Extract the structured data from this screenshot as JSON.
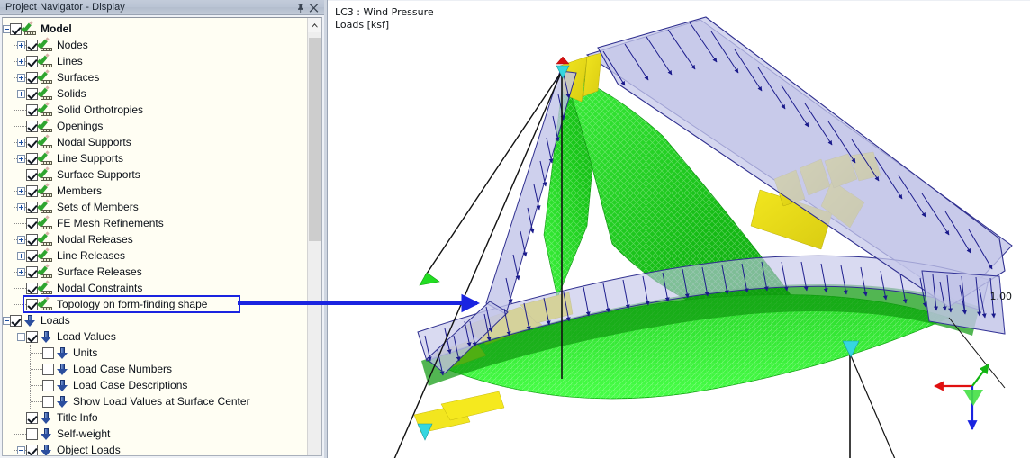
{
  "panel": {
    "title": "Project Navigator - Display",
    "pin_icon": "pin-icon",
    "close_icon": "close-icon",
    "scroll_up_icon": "chevron-up-icon"
  },
  "tree": {
    "items": [
      {
        "label": "Model",
        "depth": 0,
        "checked": true,
        "expander": "minus",
        "icon": "display-icon",
        "bold": true
      },
      {
        "label": "Nodes",
        "depth": 1,
        "checked": true,
        "expander": "plus",
        "icon": "display-icon",
        "bold": false
      },
      {
        "label": "Lines",
        "depth": 1,
        "checked": true,
        "expander": "plus",
        "icon": "display-icon",
        "bold": false
      },
      {
        "label": "Surfaces",
        "depth": 1,
        "checked": true,
        "expander": "plus",
        "icon": "display-icon",
        "bold": false
      },
      {
        "label": "Solids",
        "depth": 1,
        "checked": true,
        "expander": "plus",
        "icon": "display-icon",
        "bold": false
      },
      {
        "label": "Solid Orthotropies",
        "depth": 1,
        "checked": true,
        "expander": "none",
        "icon": "display-icon",
        "bold": false
      },
      {
        "label": "Openings",
        "depth": 1,
        "checked": true,
        "expander": "none",
        "icon": "display-icon",
        "bold": false
      },
      {
        "label": "Nodal Supports",
        "depth": 1,
        "checked": true,
        "expander": "plus",
        "icon": "display-icon",
        "bold": false
      },
      {
        "label": "Line Supports",
        "depth": 1,
        "checked": true,
        "expander": "plus",
        "icon": "display-icon",
        "bold": false
      },
      {
        "label": "Surface Supports",
        "depth": 1,
        "checked": true,
        "expander": "none",
        "icon": "display-icon",
        "bold": false
      },
      {
        "label": "Members",
        "depth": 1,
        "checked": true,
        "expander": "plus",
        "icon": "display-icon",
        "bold": false
      },
      {
        "label": "Sets of Members",
        "depth": 1,
        "checked": true,
        "expander": "plus",
        "icon": "display-icon",
        "bold": false
      },
      {
        "label": "FE Mesh Refinements",
        "depth": 1,
        "checked": true,
        "expander": "none",
        "icon": "display-icon",
        "bold": false
      },
      {
        "label": "Nodal Releases",
        "depth": 1,
        "checked": true,
        "expander": "plus",
        "icon": "display-icon",
        "bold": false
      },
      {
        "label": "Line Releases",
        "depth": 1,
        "checked": true,
        "expander": "plus",
        "icon": "display-icon",
        "bold": false
      },
      {
        "label": "Surface Releases",
        "depth": 1,
        "checked": true,
        "expander": "plus",
        "icon": "display-icon",
        "bold": false
      },
      {
        "label": "Nodal Constraints",
        "depth": 1,
        "checked": true,
        "expander": "none",
        "icon": "display-icon",
        "bold": false
      },
      {
        "label": "Topology on form-finding shape",
        "depth": 1,
        "checked": true,
        "expander": "none",
        "icon": "display-icon",
        "bold": false,
        "highlighted": true
      },
      {
        "label": "Loads",
        "depth": 0,
        "checked": true,
        "expander": "minus",
        "icon": "load-icon",
        "bold": false
      },
      {
        "label": "Load Values",
        "depth": 1,
        "checked": true,
        "expander": "minus",
        "icon": "load-icon",
        "bold": false
      },
      {
        "label": "Units",
        "depth": 2,
        "checked": false,
        "expander": "none",
        "icon": "load-icon",
        "bold": false
      },
      {
        "label": "Load Case Numbers",
        "depth": 2,
        "checked": false,
        "expander": "none",
        "icon": "load-icon",
        "bold": false
      },
      {
        "label": "Load Case Descriptions",
        "depth": 2,
        "checked": false,
        "expander": "none",
        "icon": "load-icon",
        "bold": false
      },
      {
        "label": "Show Load Values at Surface Center",
        "depth": 2,
        "checked": false,
        "expander": "none",
        "icon": "load-icon",
        "bold": false
      },
      {
        "label": "Title Info",
        "depth": 1,
        "checked": true,
        "expander": "none",
        "icon": "load-icon",
        "bold": false
      },
      {
        "label": "Self-weight",
        "depth": 1,
        "checked": false,
        "expander": "none",
        "icon": "load-icon",
        "bold": false
      },
      {
        "label": "Object Loads",
        "depth": 1,
        "checked": true,
        "expander": "minus",
        "icon": "load-icon",
        "bold": false
      }
    ]
  },
  "view": {
    "caption_line1": "LC3 : Wind Pressure",
    "caption_line2": "Loads [ksf]",
    "value_label": "1.00",
    "axis": {
      "x": "X",
      "y": "Y",
      "z": "Z"
    }
  },
  "colors": {
    "highlight_border": "#1a24e0",
    "callout_arrow": "#1a24e0",
    "axis_x": "#e01010",
    "axis_y": "#11b411",
    "axis_z": "#1a24e0",
    "load_surface": "#c2c4e8",
    "load_arrow": "#1b1b8c",
    "membrane_green_dark": "#13b413",
    "membrane_green_light": "#36e636",
    "membrane_yellow": "#e8dc18",
    "support_cyan": "#35d7e0",
    "support_green": "#22dd22",
    "panel_bg": "#eef1f6",
    "tree_bg": "#fffef3"
  }
}
